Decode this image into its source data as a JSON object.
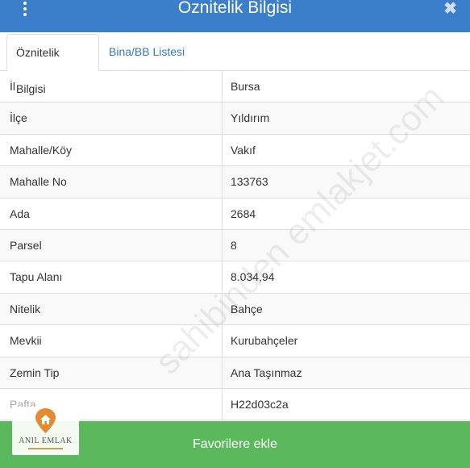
{
  "header": {
    "title": "Öznitelik Bilgisi",
    "close_glyph": "✖"
  },
  "tabs": [
    {
      "label": "Öznitelik Bilgisi",
      "active": true
    },
    {
      "label": "Bina/BB Listesi",
      "active": false
    }
  ],
  "rows": [
    {
      "label": "İl",
      "value": "Bursa"
    },
    {
      "label": "İlçe",
      "value": "Yıldırım"
    },
    {
      "label": "Mahalle/Köy",
      "value": "Vakıf"
    },
    {
      "label": "Mahalle No",
      "value": "133763"
    },
    {
      "label": "Ada",
      "value": "2684"
    },
    {
      "label": "Parsel",
      "value": "8"
    },
    {
      "label": "Tapu Alanı",
      "value": "8.034,94"
    },
    {
      "label": "Nitelik",
      "value": "Bahçe"
    },
    {
      "label": "Mevkii",
      "value": "Kurubahçeler"
    },
    {
      "label": "Zemin Tip",
      "value": "Ana Taşınmaz"
    },
    {
      "label": "Pafta",
      "value": "H22d03c2a"
    }
  ],
  "footer": {
    "button_label": "Favorilere ekle"
  },
  "logo": {
    "text": "ANIL EMLAK"
  },
  "watermark": {
    "text": "sahibinden emlakjet.com"
  },
  "colors": {
    "header": "#3b7ec9",
    "button": "#5cb85c",
    "tab_link": "#337ab7"
  }
}
